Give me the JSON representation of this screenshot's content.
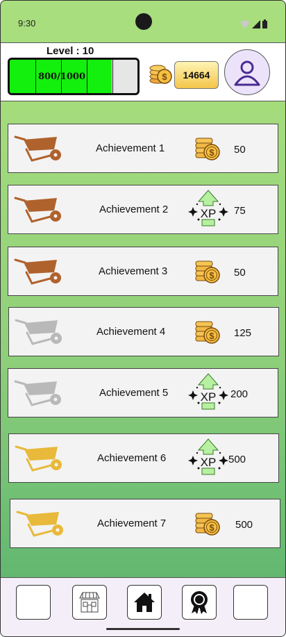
{
  "status_bar": {
    "time": "9:30"
  },
  "header": {
    "level_label": "Level : 10",
    "xp_text": "800/1000",
    "xp_fraction": 0.8,
    "coin_count": "14664"
  },
  "achievements": [
    {
      "name": "Achievement 1",
      "tier": "bronze",
      "reward_type": "coins",
      "amount": "50"
    },
    {
      "name": "Achievement 2",
      "tier": "bronze",
      "reward_type": "xp",
      "amount": "75"
    },
    {
      "name": "Achievement 3",
      "tier": "bronze",
      "reward_type": "coins",
      "amount": "50"
    },
    {
      "name": "Achievement 4",
      "tier": "silver",
      "reward_type": "coins",
      "amount": "125"
    },
    {
      "name": "Achievement 5",
      "tier": "silver",
      "reward_type": "xp",
      "amount": "200"
    },
    {
      "name": "Achievement 6",
      "tier": "gold",
      "reward_type": "xp",
      "amount": "500"
    },
    {
      "name": "Achievement 7",
      "tier": "gold",
      "reward_type": "coins",
      "amount": "500"
    }
  ],
  "xp_icon_text": "XP",
  "tier_colors": {
    "bronze": "#b0622d",
    "silver": "#b9b9b9",
    "gold": "#e8b93a"
  },
  "nav": [
    {
      "icon": "blank"
    },
    {
      "icon": "shop-icon"
    },
    {
      "icon": "home-icon"
    },
    {
      "icon": "ribbon-badge-icon"
    },
    {
      "icon": "blank"
    }
  ]
}
